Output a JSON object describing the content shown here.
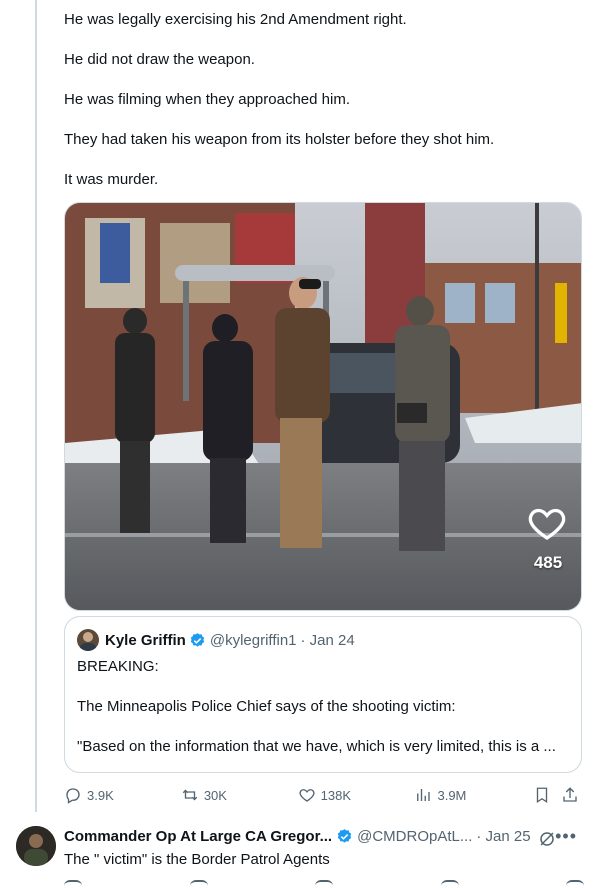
{
  "post": {
    "lines": [
      "He was legally exercising his 2nd Amendment right.",
      "He did not draw the weapon.",
      "He was filming when they approached him.",
      "They had taken his weapon from its holster before they shot him.",
      "It was murder."
    ]
  },
  "media": {
    "like_count": "485"
  },
  "quote": {
    "name": "Kyle Griffin",
    "handle": "@kylegriffin1",
    "date": "· Jan 24",
    "body": [
      "BREAKING:",
      "The Minneapolis Police Chief says of the shooting victim:",
      "\"Based on the information that we have, which is very limited, this is a ..."
    ]
  },
  "actions": {
    "replies": "3.9K",
    "reposts": "30K",
    "likes": "138K",
    "views": "3.9M"
  },
  "reply": {
    "name": "Commander Op At Large CA Gregor...",
    "handle": "@CMDROpAtL...",
    "date": "· Jan 25",
    "text": "The \" victim\" is the Border Patrol Agents"
  },
  "icons": {
    "heart": "heart-icon",
    "verified": "verified-badge-icon",
    "reply": "reply-icon",
    "repost": "repost-icon",
    "like": "like-icon",
    "views": "views-icon",
    "bookmark": "bookmark-icon",
    "share": "share-icon",
    "grok": "grok-icon",
    "more": "more-icon"
  },
  "colors": {
    "verified": "#1d9bf0",
    "muted": "#536471",
    "border": "#cfd9de"
  }
}
